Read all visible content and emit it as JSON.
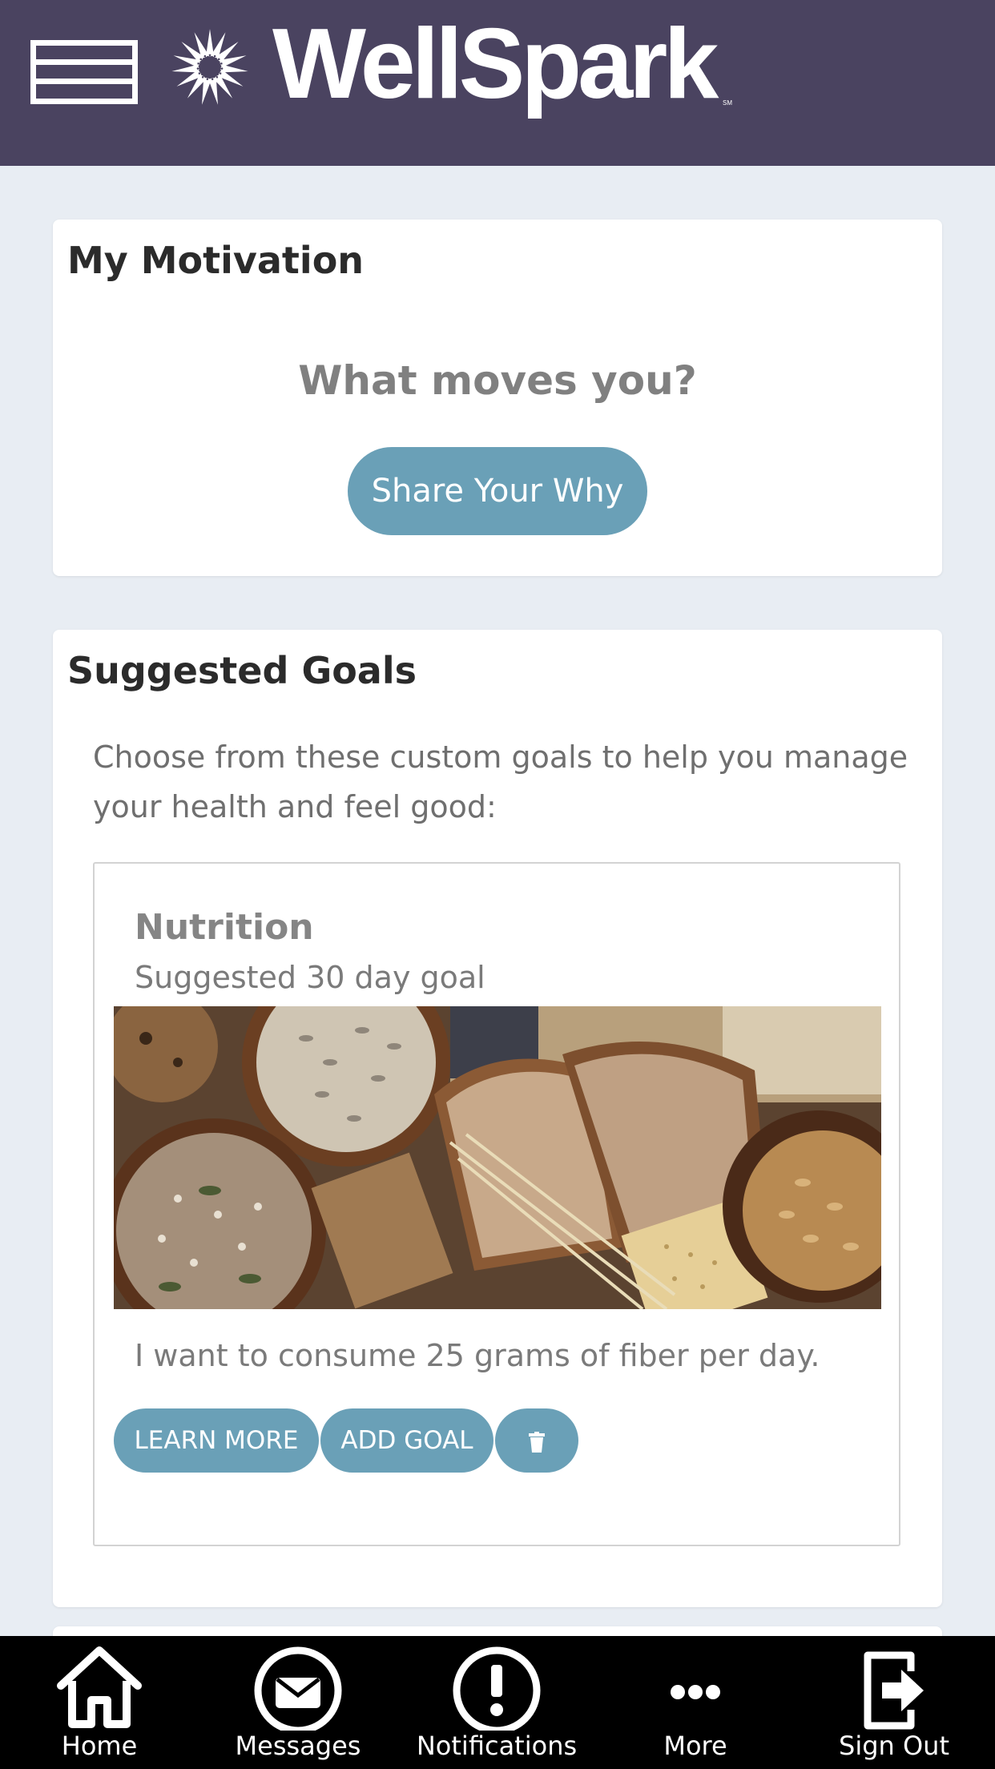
{
  "header": {
    "brand_name": "WellSpark",
    "brand_mark": "SM",
    "menu_icon": "hamburger-menu-icon",
    "logo_icon": "spark-burst-logo-icon"
  },
  "motivation": {
    "title": "My Motivation",
    "prompt": "What moves you?",
    "share_button": "Share Your Why"
  },
  "suggested_goals": {
    "title": "Suggested Goals",
    "intro": "Choose from these custom goals to help you manage your health and feel good:",
    "goals": [
      {
        "category": "Nutrition",
        "duration": "Suggested 30 day goal",
        "image_icon": "grains-bread-photo",
        "description": "I want to consume 25 grams of fiber per day.",
        "learn_more": "LEARN MORE",
        "add_goal": "ADD GOAL",
        "delete_icon": "trash-icon"
      }
    ]
  },
  "bottom_nav": {
    "items": [
      {
        "label": "Home",
        "icon": "home-icon"
      },
      {
        "label": "Messages",
        "icon": "envelope-icon"
      },
      {
        "label": "Notifications",
        "icon": "exclamation-circle-icon"
      },
      {
        "label": "More",
        "icon": "more-dots-icon"
      },
      {
        "label": "Sign Out",
        "icon": "sign-out-icon"
      }
    ]
  },
  "colors": {
    "header_bg": "#4a4360",
    "page_bg": "#e8edf3",
    "button_bg": "#6aa0b7",
    "nav_bg": "#000000"
  }
}
